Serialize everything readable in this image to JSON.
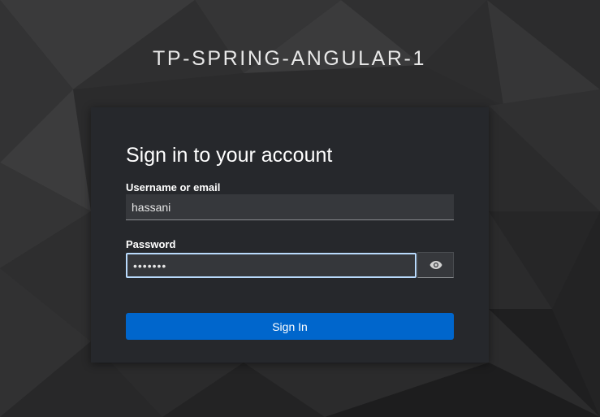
{
  "realm": {
    "title": "TP-SPRING-ANGULAR-1"
  },
  "login": {
    "heading": "Sign in to your account",
    "username_label": "Username or email",
    "username_value": "hassani",
    "password_label": "Password",
    "password_value": "•••••••",
    "show_password_icon": "eye-icon",
    "signin_label": "Sign In"
  },
  "colors": {
    "primary_button": "#0066cc",
    "card_background": "#26282c",
    "focus_border": "#b9dafc"
  }
}
